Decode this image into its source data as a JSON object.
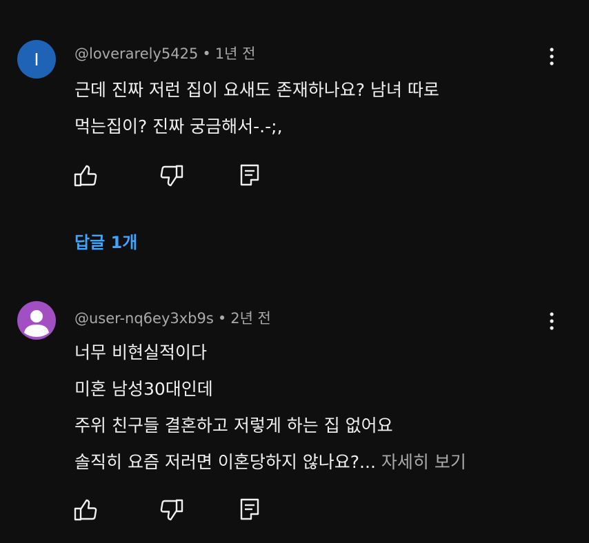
{
  "comments": [
    {
      "avatar_letter": "I",
      "avatar_color": "#1f63b6",
      "author": "@loverarely5425",
      "separator": "•",
      "time": "1년 전",
      "lines": [
        "근데 진짜 저런 집이 요새도 존재하나요? 남녀 따로",
        "먹는집이? 진짜 궁금해서-.-;,"
      ],
      "more_label": "",
      "icons": [
        "like-icon",
        "dislike-icon",
        "reply-icon",
        "more-vert-icon"
      ]
    },
    {
      "avatar_icon": "person-icon",
      "avatar_color": "#a14fc2",
      "author": "@user-nq6ey3xb9s",
      "separator": "•",
      "time": "2년 전",
      "lines": [
        "너무 비현실적이다",
        "미혼 남성30대인데",
        "주위 친구들 결혼하고 저렇게 하는 집 없어요",
        "솔직히 요즘 저러면 이혼당하지 않나요?..."
      ],
      "more_label": "자세히 보기",
      "icons": [
        "like-icon",
        "dislike-icon",
        "reply-icon",
        "more-vert-icon"
      ]
    }
  ],
  "replies_label": "답글 1개",
  "colors": {
    "background": "#0f0f0f",
    "text": "#f1f1f1",
    "secondary": "#aaaaaa",
    "link": "#3ea6ff"
  }
}
